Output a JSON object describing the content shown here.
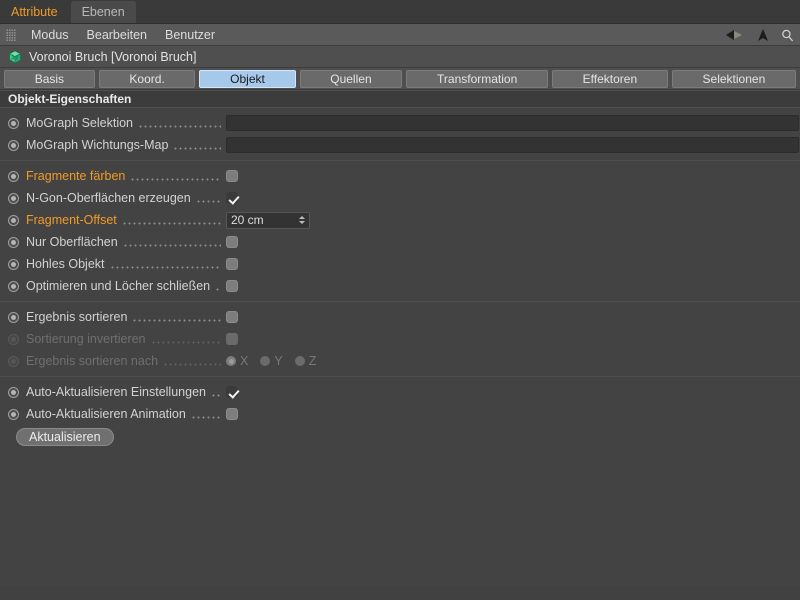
{
  "window_tabs": [
    {
      "label": "Attribute",
      "active": true
    },
    {
      "label": "Ebenen",
      "active": false
    }
  ],
  "menubar": {
    "grip_icon": "grip-dots-icon",
    "items": [
      "Modus",
      "Bearbeiten",
      "Benutzer"
    ],
    "nav_icons": [
      "back-arrow-icon",
      "forward-arrow-icon",
      "up-arrow-icon",
      "search-icon"
    ]
  },
  "object_header": {
    "icon": "voronoi-fracture-cube-icon",
    "title": "Voronoi Bruch [Voronoi Bruch]"
  },
  "tabs": [
    {
      "label": "Basis",
      "active": false
    },
    {
      "label": "Koord.",
      "active": false
    },
    {
      "label": "Objekt",
      "active": true
    },
    {
      "label": "Quellen",
      "active": false
    },
    {
      "label": "Transformation",
      "active": false
    },
    {
      "label": "Effektoren",
      "active": false
    },
    {
      "label": "Selektionen",
      "active": false
    }
  ],
  "section": {
    "title": "Objekt-Eigenschaften"
  },
  "properties": {
    "mograph_selektion": {
      "label": "MoGraph Selektion",
      "value": ""
    },
    "mograph_wichtungs_map": {
      "label": "MoGraph Wichtungs-Map",
      "value": ""
    },
    "fragmente_faerben": {
      "label": "Fragmente färben",
      "checked": false
    },
    "ngon_oberflaechen": {
      "label": "N-Gon-Oberflächen erzeugen",
      "checked": true
    },
    "fragment_offset": {
      "label": "Fragment-Offset",
      "value": "20 cm"
    },
    "nur_oberflaechen": {
      "label": "Nur Oberflächen",
      "checked": false
    },
    "hohles_objekt": {
      "label": "Hohles Objekt",
      "checked": false
    },
    "optimieren": {
      "label": "Optimieren und Löcher schließen",
      "checked": false
    },
    "ergebnis_sortieren": {
      "label": "Ergebnis sortieren",
      "checked": false
    },
    "sortierung_invertieren": {
      "label": "Sortierung invertieren",
      "checked": false
    },
    "ergebnis_sortieren_nach": {
      "label": "Ergebnis sortieren nach",
      "options": [
        "X",
        "Y",
        "Z"
      ],
      "selected": "X"
    },
    "auto_einstellungen": {
      "label": "Auto-Aktualisieren Einstellungen",
      "checked": true
    },
    "auto_animation": {
      "label": "Auto-Aktualisieren Animation",
      "checked": false
    },
    "aktualisieren_button": {
      "label": "Aktualisieren"
    }
  },
  "colors": {
    "animated_label": "#f09a28",
    "active_tab": "#a6c8ea",
    "panel_bg": "#434343",
    "object_icon": "#3ec98a"
  }
}
